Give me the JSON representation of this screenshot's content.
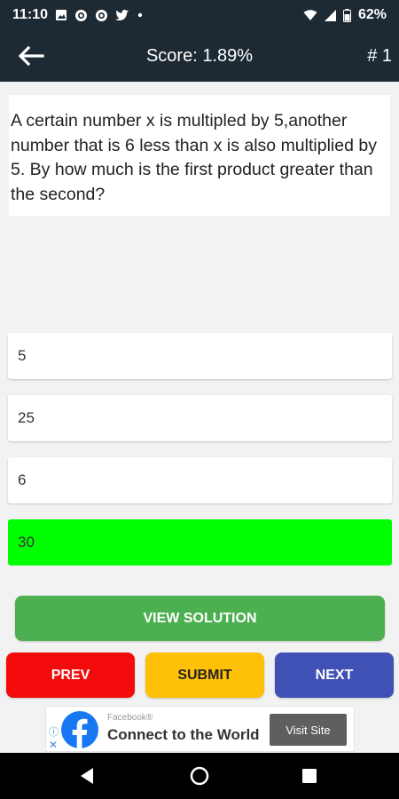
{
  "status_bar": {
    "time": "11:10",
    "battery": "62%",
    "icons": [
      "image-icon",
      "circle-app-icon",
      "circle-app-icon",
      "twitter-icon",
      "dot-icon",
      "wifi-icon",
      "signal-icon",
      "battery-icon"
    ]
  },
  "app_bar": {
    "back_icon": "arrow-left-icon",
    "score": "Score: 1.89%",
    "question_number": "# 1"
  },
  "question": {
    "text": "A certain number x is multipled by 5,another number that is 6 less than x is also multiplied by 5. By how much is the first product greater than the second?"
  },
  "options": [
    {
      "label": "5",
      "selected": false
    },
    {
      "label": "25",
      "selected": false
    },
    {
      "label": "6",
      "selected": false
    },
    {
      "label": "30",
      "selected": true
    }
  ],
  "buttons": {
    "view_solution": "VIEW SOLUTION",
    "prev": "PREV",
    "submit": "SUBMIT",
    "next": "NEXT"
  },
  "ad": {
    "sponsor": "Facebook®",
    "title": "Connect to the World",
    "cta": "Visit Site",
    "info_icon": "info-icon",
    "close_icon": "close-icon"
  },
  "colors": {
    "app_bar": "#1d2a33",
    "selected_option": "#00ff00",
    "view_solution": "#4caf50",
    "prev": "#f40b0b",
    "submit": "#ffc107",
    "next": "#3f51b5"
  }
}
